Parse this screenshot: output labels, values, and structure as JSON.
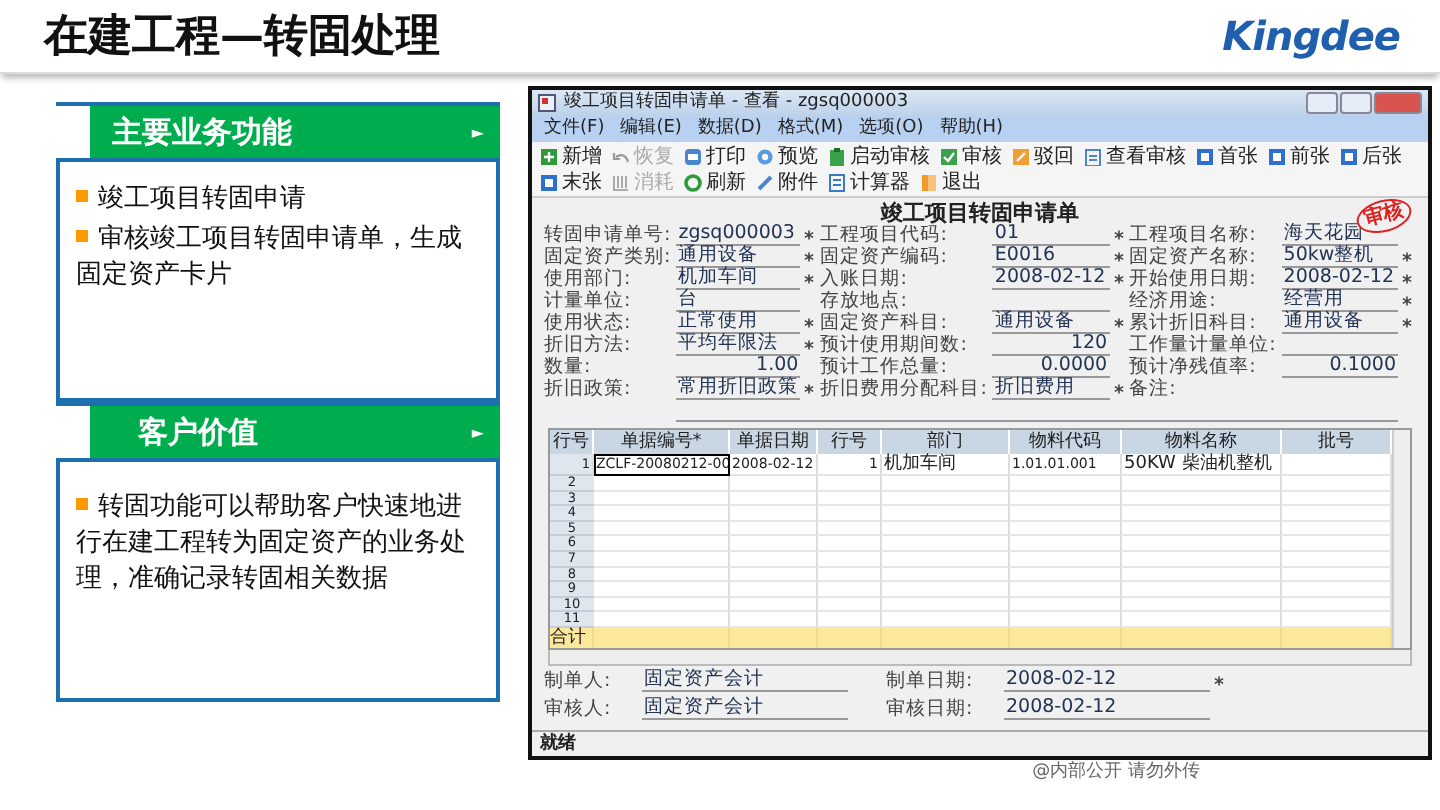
{
  "slide": {
    "title": "在建工程—转固处理",
    "logo": "Kingdee",
    "footer_note": "@内部公开 请勿外传"
  },
  "sections": [
    {
      "title": "主要业务功能",
      "arrow": "►",
      "bullets": [
        "竣工项目转固申请",
        "审核竣工项目转固申请单，生成固定资产卡片"
      ]
    },
    {
      "title": "客户价值",
      "arrow": "►",
      "bullets": [
        "转固功能可以帮助客户快速地进行在建工程转为固定资产的业务处理，准确记录转固相关数据"
      ]
    }
  ],
  "window": {
    "title": "竣工项目转固申请单 - 查看 - zgsq000003",
    "menu": [
      "文件(F)",
      "编辑(E)",
      "数据(D)",
      "格式(M)",
      "选项(O)",
      "帮助(H)"
    ],
    "toolbar": [
      {
        "label": "新增",
        "kind": "add",
        "disabled": false
      },
      {
        "label": "恢复",
        "kind": "undo",
        "disabled": true
      },
      {
        "label": "打印",
        "kind": "print",
        "disabled": false
      },
      {
        "label": "预览",
        "kind": "preview",
        "disabled": false
      },
      {
        "label": "启动审核",
        "kind": "clipboard",
        "disabled": false
      },
      {
        "label": "审核",
        "kind": "check",
        "disabled": false
      },
      {
        "label": "驳回",
        "kind": "reject",
        "disabled": false
      },
      {
        "label": "查看审核",
        "kind": "view",
        "disabled": false
      },
      {
        "label": "首张",
        "kind": "nav",
        "disabled": false
      },
      {
        "label": "前张",
        "kind": "nav",
        "disabled": false
      },
      {
        "label": "后张",
        "kind": "nav",
        "disabled": false
      },
      {
        "label": "末张",
        "kind": "nav",
        "disabled": false
      },
      {
        "label": "消耗",
        "kind": "grid",
        "disabled": true
      },
      {
        "label": "刷新",
        "kind": "refresh",
        "disabled": false
      },
      {
        "label": "附件",
        "kind": "pen",
        "disabled": false
      },
      {
        "label": "计算器",
        "kind": "calc",
        "disabled": false
      },
      {
        "label": "退出",
        "kind": "exit",
        "disabled": false
      }
    ],
    "form_title": "竣工项目转固申请单",
    "stamp": "审核",
    "fields": [
      {
        "label": "转固申请单号:",
        "value": "zgsq000003",
        "required": true
      },
      {
        "label": "工程项目代码:",
        "value": "01",
        "required": true
      },
      {
        "label": "工程项目名称:",
        "value": "海天花园",
        "required": false
      },
      {
        "label": "固定资产类别:",
        "value": "通用设备",
        "required": true
      },
      {
        "label": "固定资产编码:",
        "value": "E0016",
        "required": true
      },
      {
        "label": "固定资产名称:",
        "value": "50kw整机",
        "required": true
      },
      {
        "label": "使用部门:",
        "value": "机加车间",
        "required": true
      },
      {
        "label": "入账日期:",
        "value": "2008-02-12",
        "required": true
      },
      {
        "label": "开始使用日期:",
        "value": "2008-02-12",
        "required": true
      },
      {
        "label": "计量单位:",
        "value": "台",
        "required": false
      },
      {
        "label": "存放地点:",
        "required": false
      },
      {
        "label": "经济用途:",
        "value": "经营用",
        "required": true
      },
      {
        "label": "使用状态:",
        "value": "正常使用",
        "required": true
      },
      {
        "label": "固定资产科目:",
        "value": "通用设备",
        "required": true
      },
      {
        "label": "累计折旧科目:",
        "value": "通用设备",
        "required": true
      },
      {
        "label": "折旧方法:",
        "value": "平均年限法",
        "required": true
      },
      {
        "label": "预计使用期间数:",
        "value": "120",
        "required": false,
        "kind": "number"
      },
      {
        "label": "工作量计量单位:",
        "required": false
      },
      {
        "label": "数量:",
        "value": "1.00",
        "required": false,
        "kind": "number"
      },
      {
        "label": "预计工作总量:",
        "value": "0.0000",
        "required": false,
        "kind": "number"
      },
      {
        "label": "预计净残值率:",
        "value": "0.1000",
        "required": false,
        "kind": "number"
      },
      {
        "label": "折旧政策:",
        "value": "常用折旧政策",
        "required": true
      },
      {
        "label": "折旧费用分配科目:",
        "value": "折旧费用",
        "required": true
      },
      {
        "label": "备注:",
        "required": false,
        "kind": "wide"
      }
    ],
    "table": {
      "columns": [
        "行号",
        "单据编号*",
        "单据日期",
        "行号",
        "部门",
        "物料代码",
        "物料名称",
        "批号"
      ],
      "rows": [
        {
          "no": "1",
          "cells": [
            "ZCLF-20080212-00",
            "2008-02-12",
            "1",
            "机加车间",
            "1.01.01.001",
            "50KW 柴油机整机"
          ]
        },
        {
          "no": "2"
        },
        {
          "no": "3"
        },
        {
          "no": "4"
        },
        {
          "no": "5"
        },
        {
          "no": "6"
        },
        {
          "no": "7"
        },
        {
          "no": "8"
        },
        {
          "no": "9"
        },
        {
          "no": "10"
        },
        {
          "no": "11"
        }
      ],
      "total_label": "合计"
    },
    "footer_fields": [
      {
        "label": "制单人:",
        "value": "固定资产会计",
        "required": false
      },
      {
        "label": "制单日期:",
        "value": "2008-02-12",
        "required": true
      },
      {
        "label": "审核人:",
        "value": "固定资产会计",
        "required": false
      },
      {
        "label": "审核日期:",
        "value": "2008-02-12",
        "required": false
      }
    ],
    "status": "就绪"
  }
}
